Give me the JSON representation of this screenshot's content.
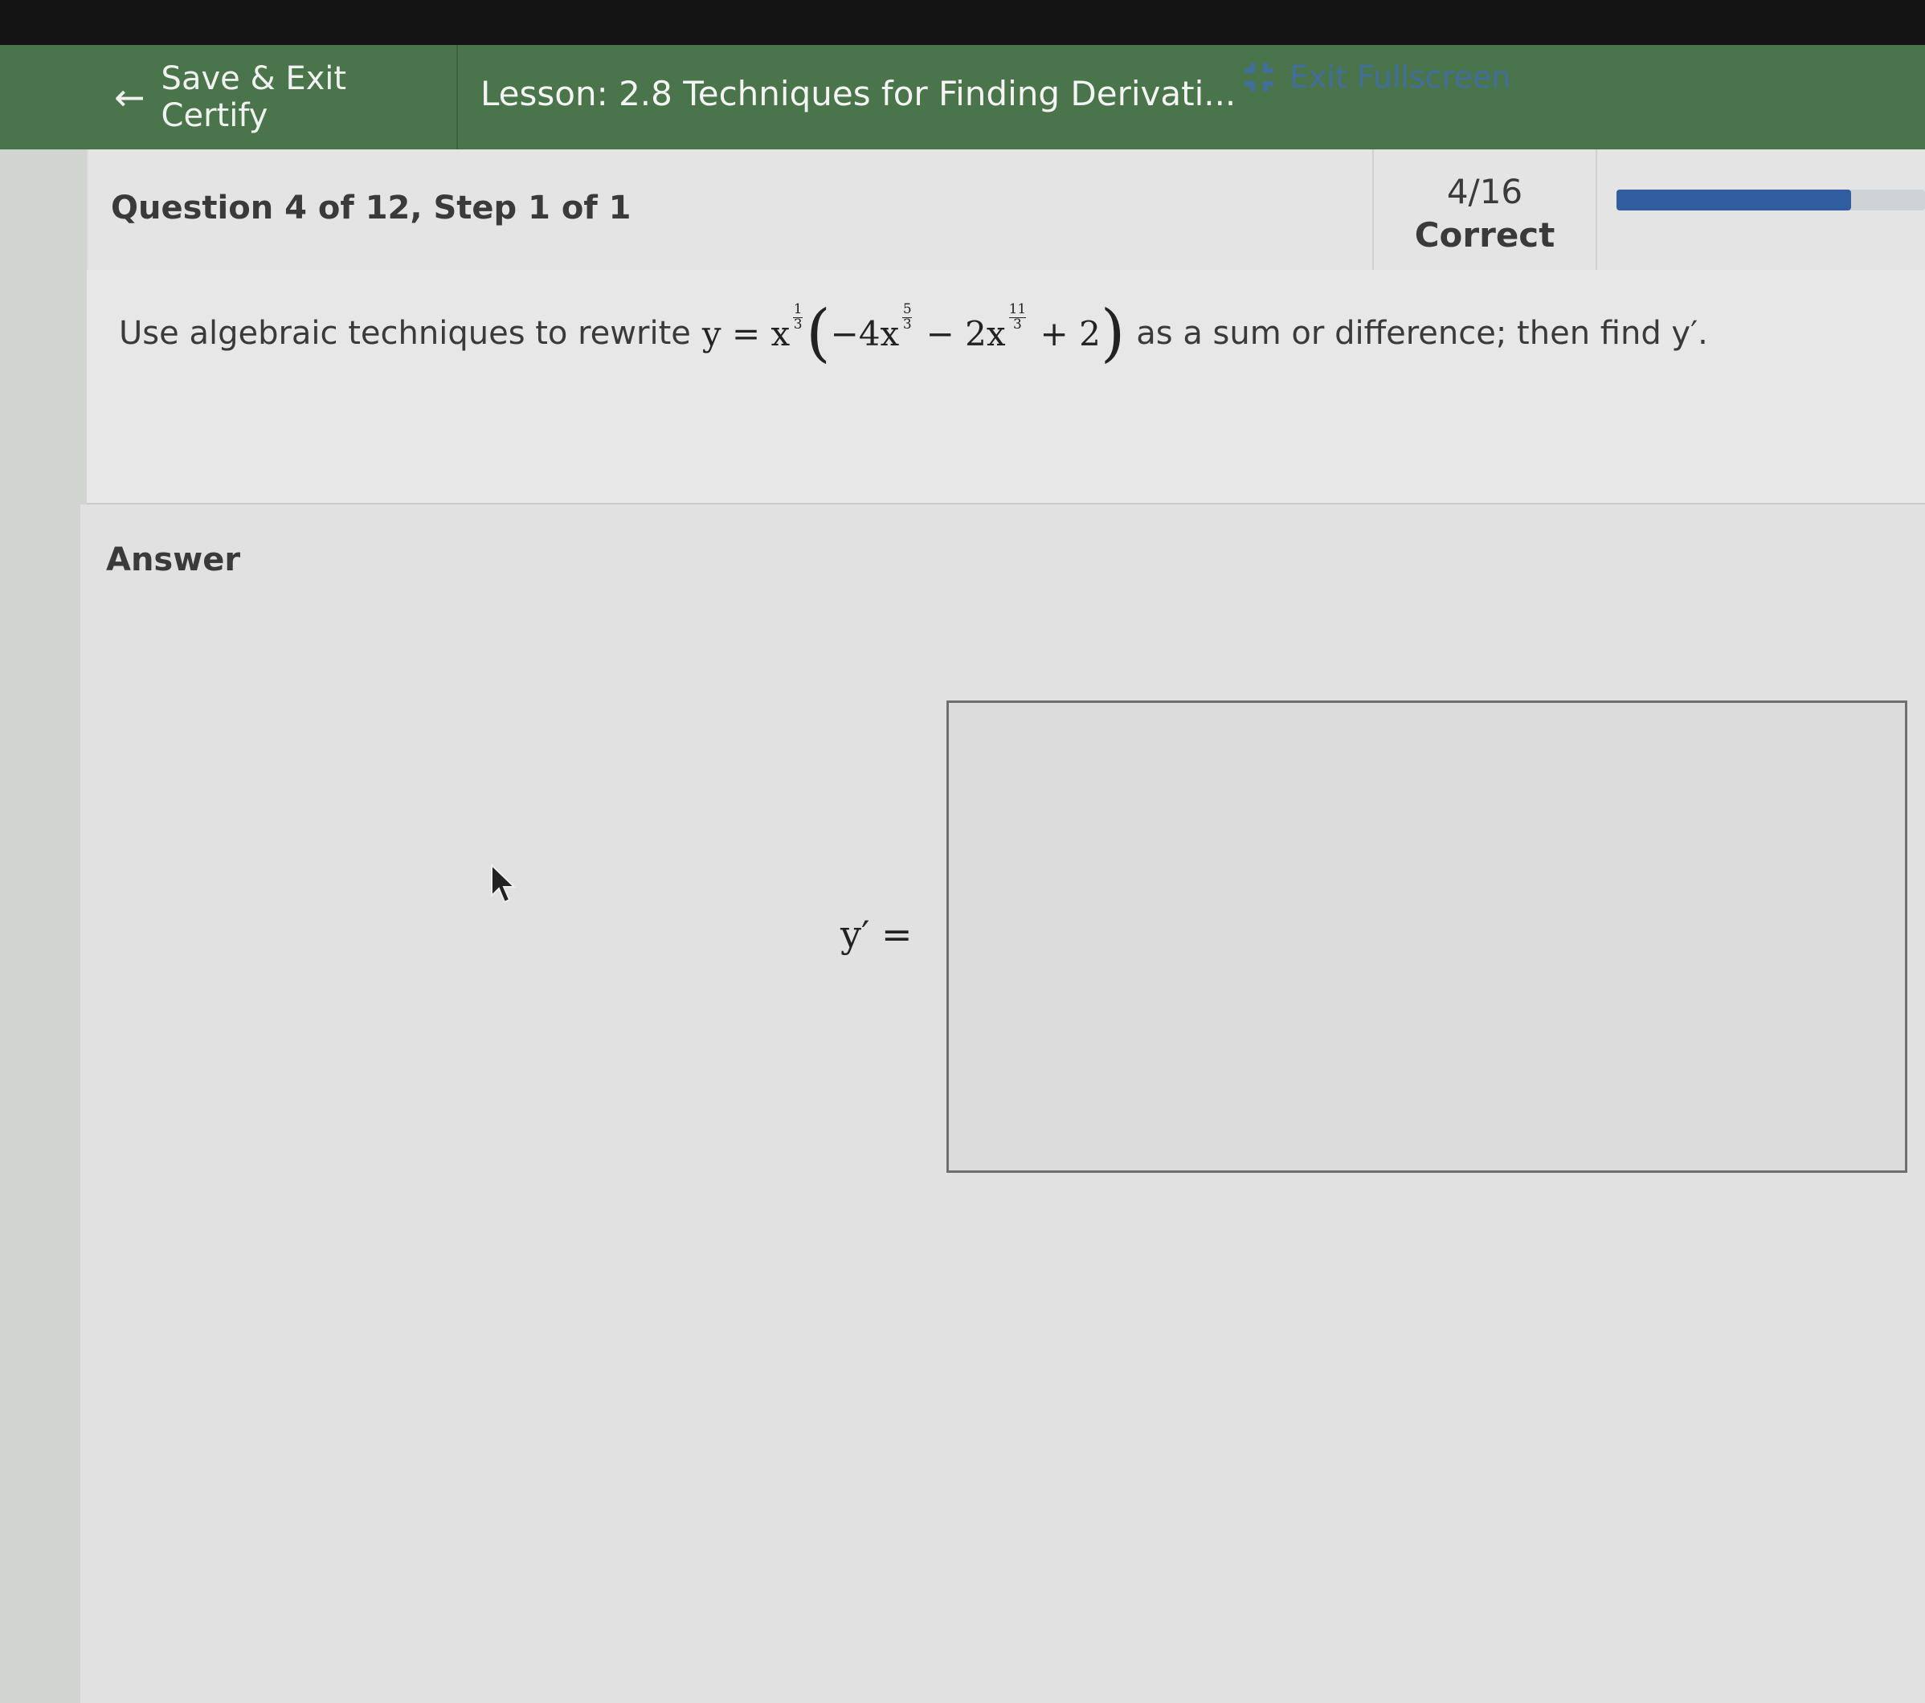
{
  "header": {
    "back_label": "Save & Exit Certify",
    "lesson_title": "Lesson: 2.8 Techniques for Finding Derivati...",
    "exit_fullscreen_label": "Exit Fullscreen",
    "colors": {
      "bar": "#4a7449",
      "exit": "#3f6cc2"
    }
  },
  "question_bar": {
    "label": "Question 4 of 12, Step 1 of 1",
    "score": "4/16",
    "score_label": "Correct",
    "progress": 0.76,
    "progress_color": "#2f5d9e"
  },
  "question": {
    "prefix": "Use algebraic techniques to rewrite",
    "math": {
      "y": "y",
      "eq": " = ",
      "x1": "x",
      "e1_num": "1",
      "e1_den": "3",
      "lparen": "(",
      "t1": "−4x",
      "e2_num": "5",
      "e2_den": "3",
      "minus": " − ",
      "t2": "2x",
      "e3_num": "11",
      "e3_den": "3",
      "plus": " + 2",
      "rparen": ")"
    },
    "suffix": "as a sum or difference; then find y′."
  },
  "answer": {
    "label": "Answer",
    "lhs": "y′ =",
    "input_value": ""
  }
}
